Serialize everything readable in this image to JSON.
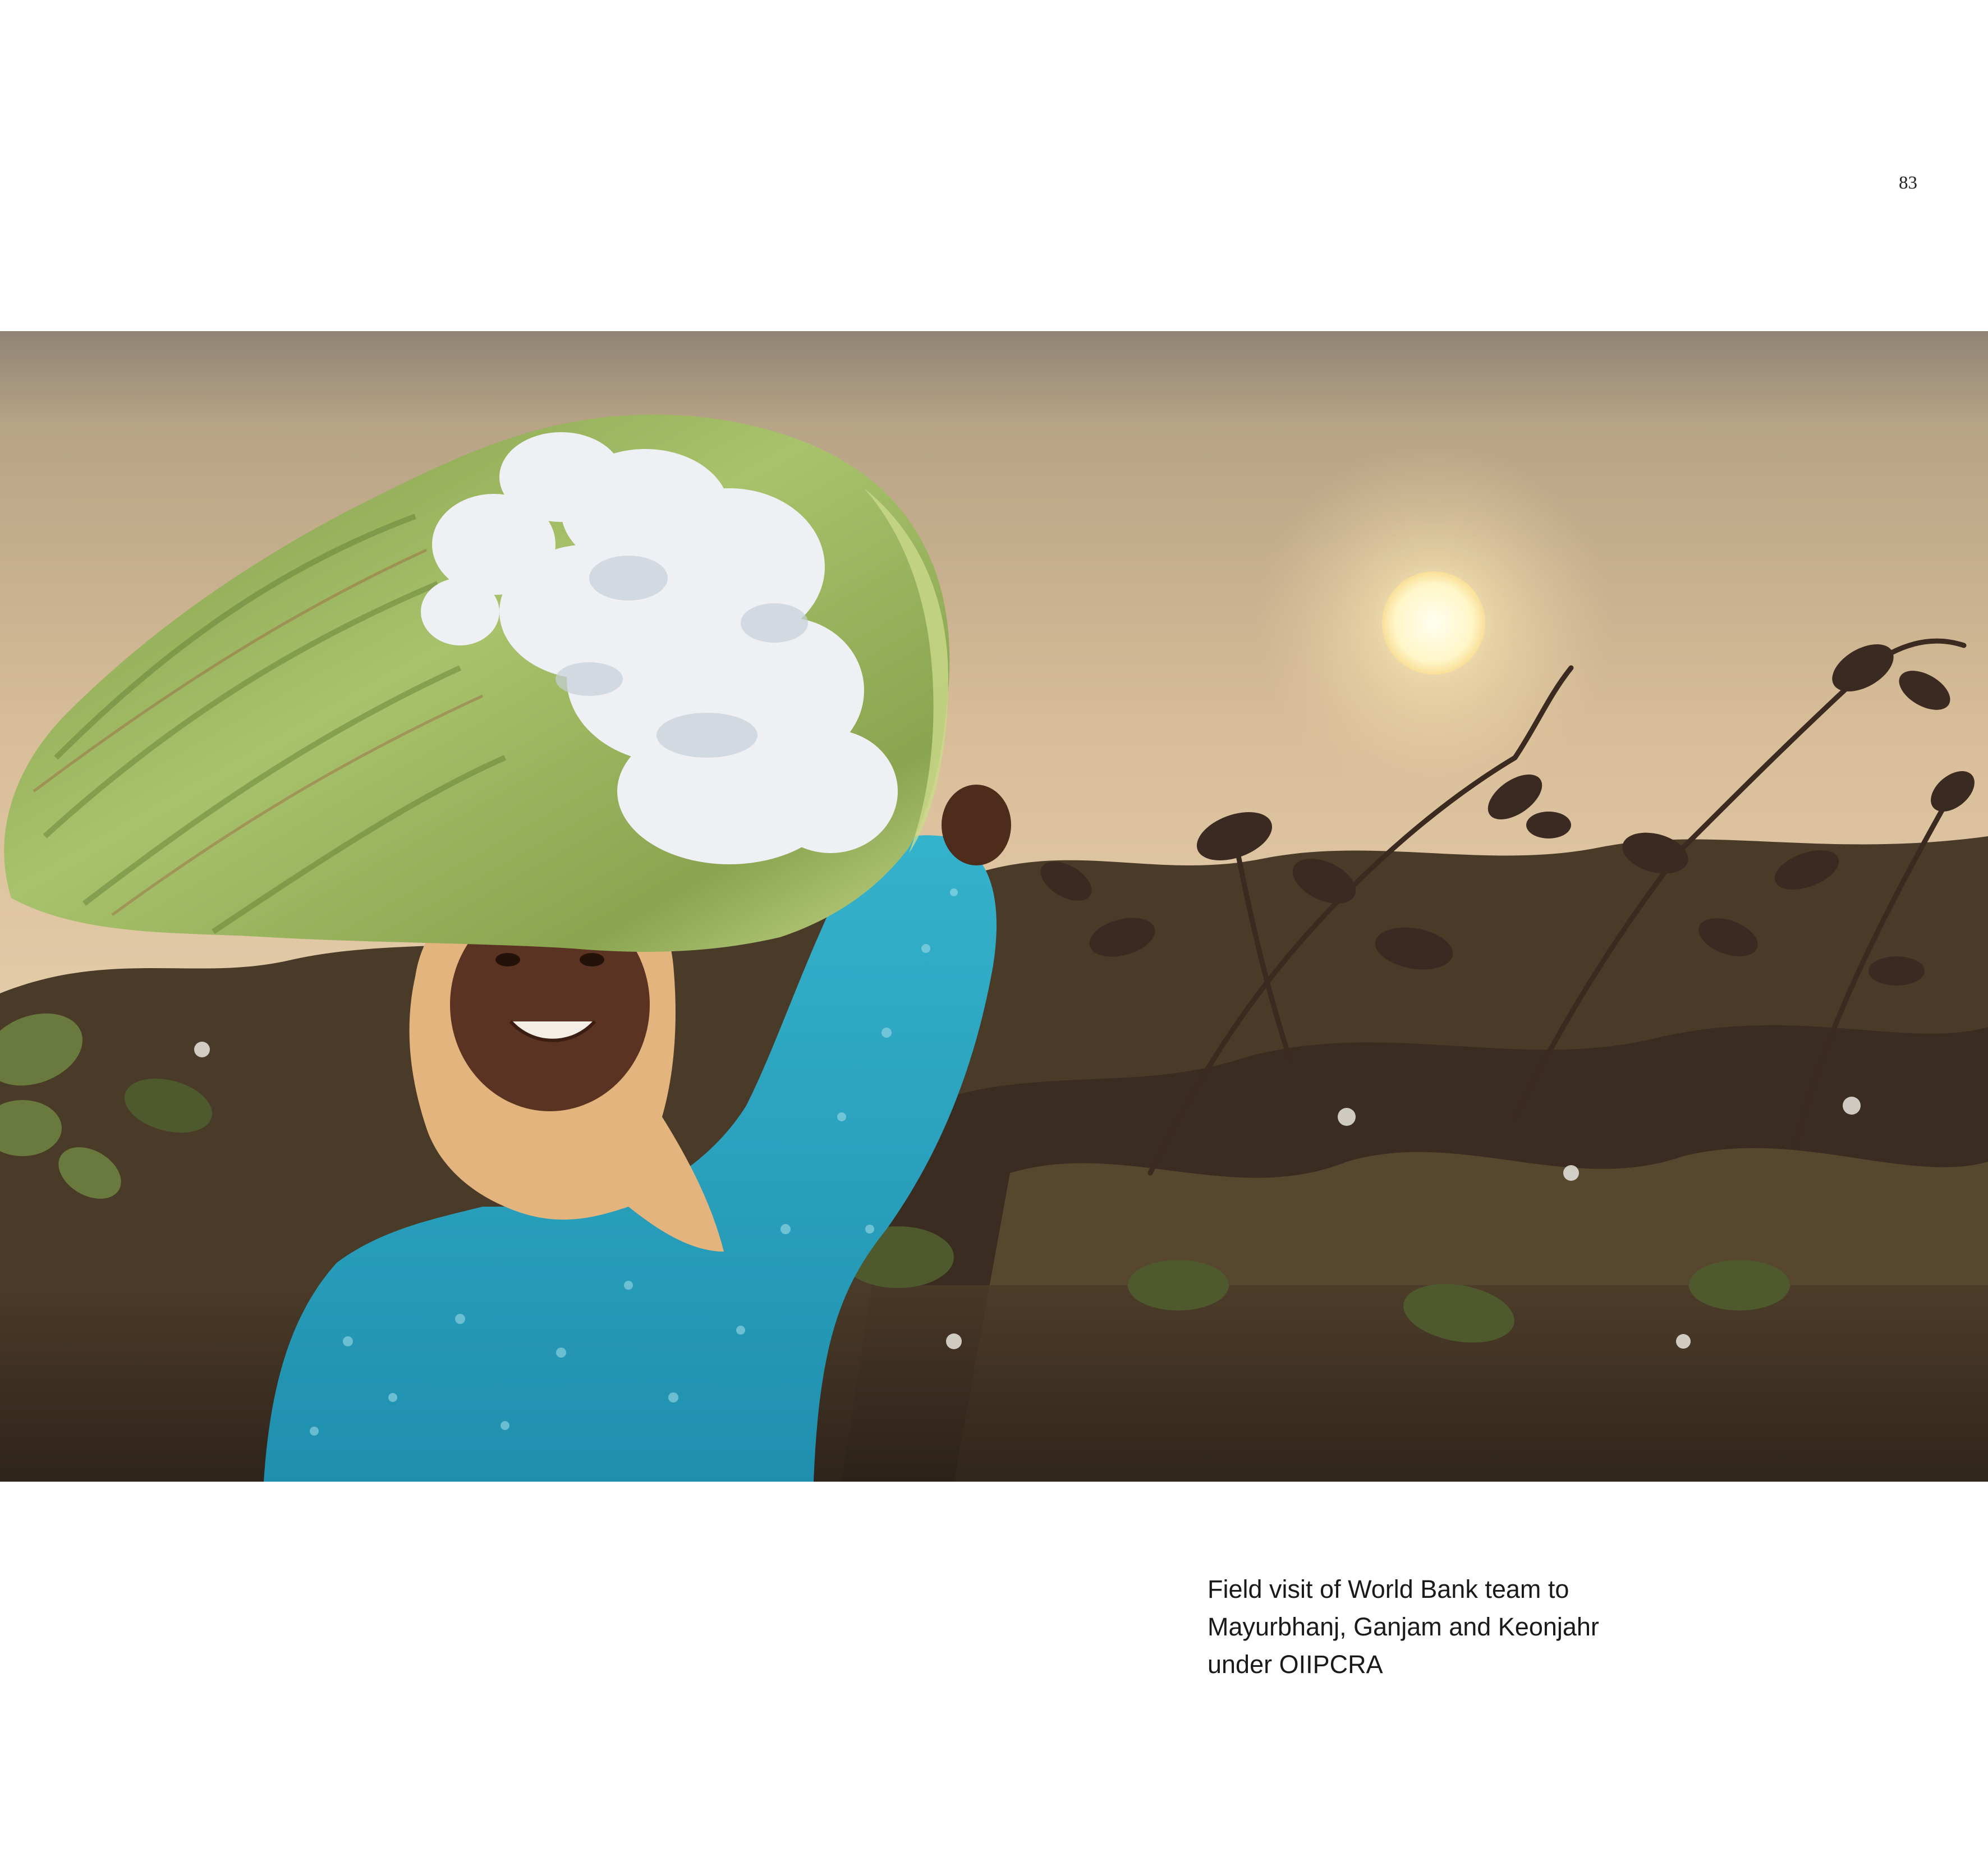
{
  "page": {
    "number": "83"
  },
  "photo": {
    "subject": "woman-carrying-cotton-sack-at-sunset",
    "colors": {
      "sky_top": "#8f8474",
      "sky_mid": "#d8bd98",
      "sky_low": "#e9d2b1",
      "sun": "#fff6c8",
      "foliage_dark": "#3a2a20",
      "foliage_mid": "#5b4a33",
      "foliage_green": "#5f6b3a",
      "sack_green": "#98b25e",
      "cotton": "#eef0f3",
      "shirt_teal": "#2aa5c2",
      "scarf_tan": "#e3b47d",
      "skin": "#5a3322"
    }
  },
  "caption": {
    "lines": [
      "Field visit of World Bank team to",
      "Mayurbhanj, Ganjam and Keonjahr",
      "under OIIPCRA"
    ]
  }
}
